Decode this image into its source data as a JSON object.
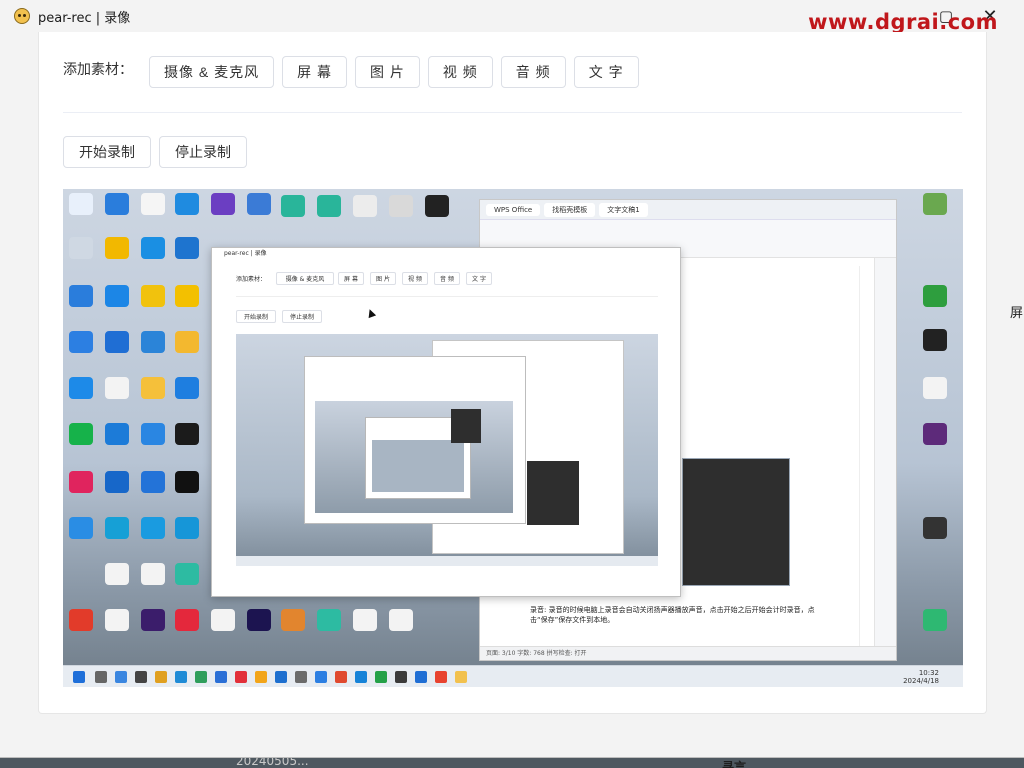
{
  "window": {
    "title": "pear-rec | 录像",
    "watermark": "www.dgrai.com"
  },
  "materials": {
    "label": "添加素材：",
    "buttons": [
      "摄像 & 麦克风",
      "屏 幕",
      "图 片",
      "视 频",
      "音 频",
      "文 字"
    ]
  },
  "record": {
    "start_label": "开始录制",
    "stop_label": "停止录制"
  },
  "preview": {
    "taskbar_time": "10:32",
    "taskbar_date": "2024/4/18",
    "wps": {
      "tabs": [
        "WPS Office",
        "找稻壳模板",
        "文字文稿1"
      ],
      "status": "页面: 3/10   字数: 768   拼写检查: 打开",
      "zoom": "100%",
      "body_text": "录音: 录音的时候电脑上录音会自动关闭扬声器播放声音，点击开始之后开始会计时录音，点击“保存”保存文件到本地。"
    },
    "nested": {
      "title": "pear-rec | 录像",
      "materials_label": "添加素材：",
      "buttons": [
        "摄像 & 麦克风",
        "屏 幕",
        "图 片",
        "视 频",
        "音 频",
        "文 字"
      ],
      "start_label": "开始录制",
      "stop_label": "停止录制"
    }
  },
  "background": {
    "peek_text_left": "20240505...",
    "peek_text_right": "寻言",
    "side_text": "屏"
  },
  "colors": {
    "watermark": "#c0171b",
    "window_bg": "#f3f3f3",
    "card_bg": "#ffffff",
    "button_border": "#dcdfe6"
  }
}
